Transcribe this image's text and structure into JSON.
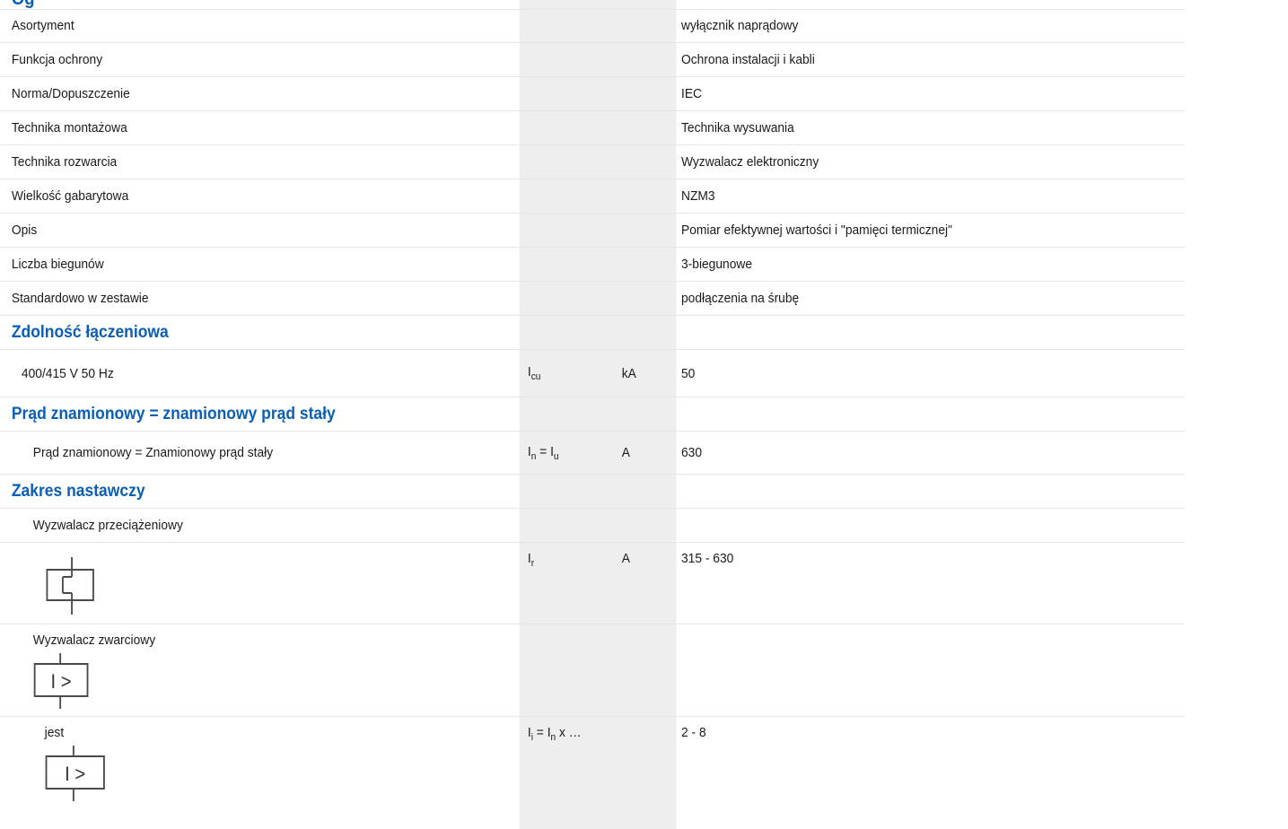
{
  "header": {
    "cut_title": "Og"
  },
  "rows": [
    {
      "label": "Asortyment",
      "value": "wyłącznik naprądowy"
    },
    {
      "label": "Funkcja ochrony",
      "value": "Ochrona instalacji i kabli"
    },
    {
      "label": "Norma/Dopuszczenie",
      "value": "IEC"
    },
    {
      "label": "Technika montażowa",
      "value": "Technika wysuwania"
    },
    {
      "label": "Technika rozwarcia",
      "value": "Wyzwalacz elektroniczny"
    },
    {
      "label": "Wielkość gabarytowa",
      "value": "NZM3"
    },
    {
      "label": "Opis",
      "value": "Pomiar efektywnej wartości i \"pamięci termicznej\""
    },
    {
      "label": "Liczba biegunów",
      "value": "3-biegunowe"
    },
    {
      "label": "Standardowo w zestawie",
      "value": "podłączenia na śrubę"
    }
  ],
  "switching_capacity": {
    "title": "Zdolność łączeniowa",
    "row": {
      "label": "400/415 V 50 Hz",
      "sym": "I",
      "sub": "cu",
      "unit": "kA",
      "value": "50"
    }
  },
  "rated_current": {
    "title": "Prąd znamionowy = znamionowy prąd stały",
    "row": {
      "label": "Prąd znamionowy = Znamionowy prąd stały",
      "sym_a": "I",
      "sub_a": "n",
      "eq": " = ",
      "sym_b": "I",
      "sub_b": "u",
      "unit": "A",
      "value": "630"
    }
  },
  "setting_range": {
    "title": "Zakres nastawczy",
    "overload_label": "Wyzwalacz przeciążeniowy",
    "overload": {
      "sym": "I",
      "sub": "r",
      "unit": "A",
      "value": "315 - 630"
    },
    "short_circuit_label": "Wyzwalacz zwarciowy",
    "short_circuit_symbol_text": "I >",
    "instant": {
      "label": "jest",
      "sym_a": "I",
      "sub_a": "i",
      "eq": " = ",
      "sym_b": "I",
      "sub_b": "n",
      "tail": " x …",
      "value": "2 - 8",
      "symbol_text": "I >"
    }
  }
}
